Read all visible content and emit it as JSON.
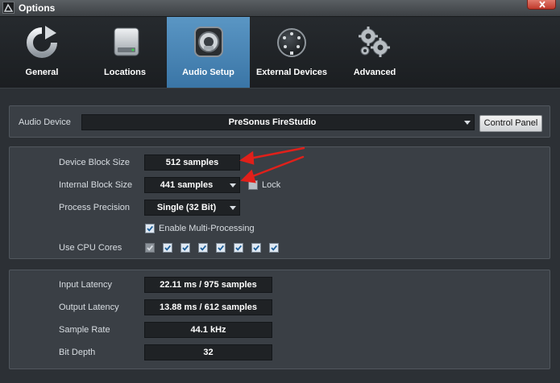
{
  "window": {
    "title": "Options"
  },
  "tabs": [
    {
      "label": "General",
      "icon": "refresh-icon"
    },
    {
      "label": "Locations",
      "icon": "hard-drive-icon"
    },
    {
      "label": "Audio Setup",
      "icon": "speaker-icon",
      "active": true
    },
    {
      "label": "External Devices",
      "icon": "midi-connector-icon"
    },
    {
      "label": "Advanced",
      "icon": "gears-icon"
    }
  ],
  "audio_device": {
    "label": "Audio Device",
    "value": "PreSonus FireStudio",
    "control_panel_label": "Control Panel"
  },
  "block": {
    "device_block_size_label": "Device Block Size",
    "device_block_size_value": "512 samples",
    "internal_block_size_label": "Internal Block Size",
    "internal_block_size_value": "441 samples",
    "lock_label": "Lock",
    "lock_checked": false,
    "process_precision_label": "Process Precision",
    "process_precision_value": "Single (32 Bit)",
    "multi_processing_label": "Enable Multi-Processing",
    "multi_processing_checked": true,
    "cpu_cores_label": "Use CPU Cores",
    "cpu_cores": [
      {
        "checked": true,
        "enabled": false
      },
      {
        "checked": true,
        "enabled": true
      },
      {
        "checked": true,
        "enabled": true
      },
      {
        "checked": true,
        "enabled": true
      },
      {
        "checked": true,
        "enabled": true
      },
      {
        "checked": true,
        "enabled": true
      },
      {
        "checked": true,
        "enabled": true
      },
      {
        "checked": true,
        "enabled": true
      }
    ]
  },
  "info": {
    "input_latency_label": "Input Latency",
    "input_latency_value": "22.11 ms / 975 samples",
    "output_latency_label": "Output Latency",
    "output_latency_value": "13.88 ms / 612 samples",
    "sample_rate_label": "Sample Rate",
    "sample_rate_value": "44.1 kHz",
    "bit_depth_label": "Bit Depth",
    "bit_depth_value": "32"
  },
  "colors": {
    "active_tab": "#4a86b6",
    "annotation_arrow": "#e0201a"
  }
}
